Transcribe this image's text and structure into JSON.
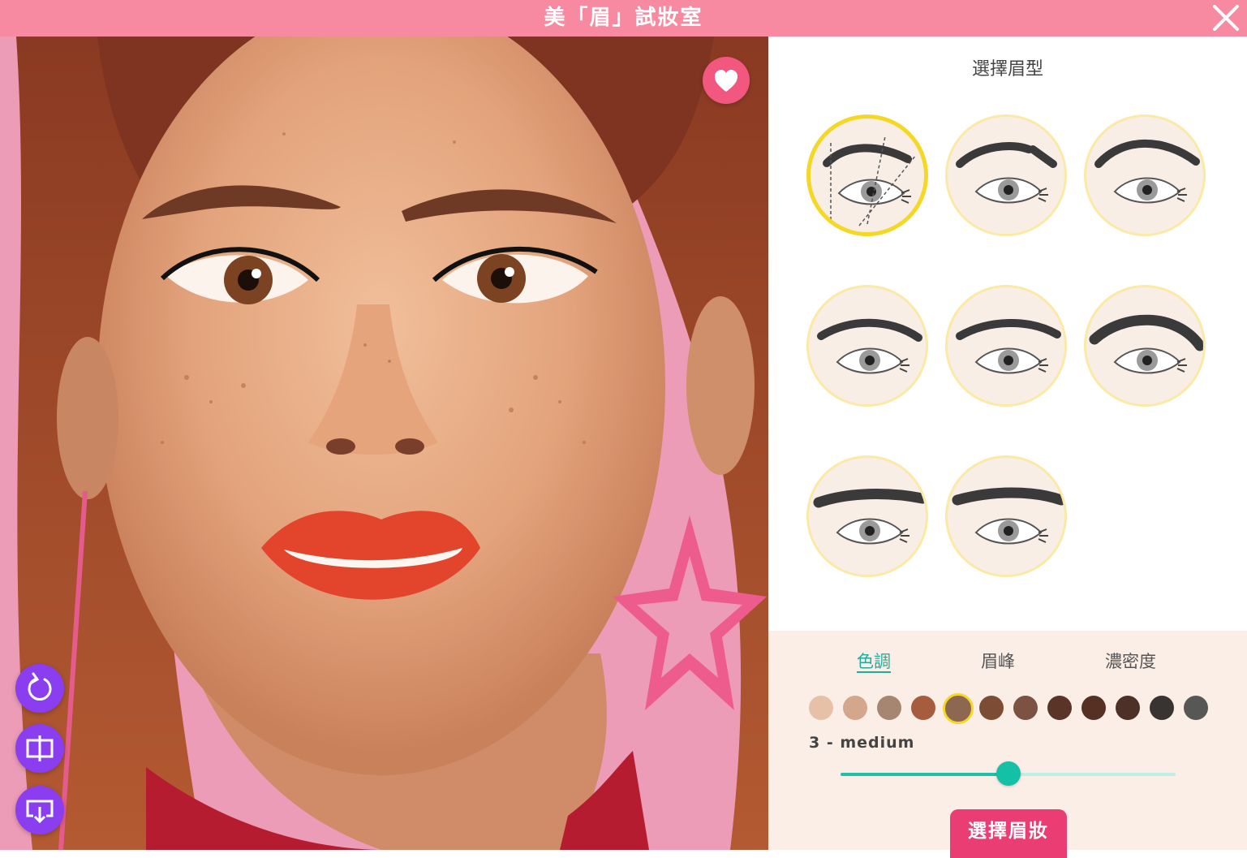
{
  "app": {
    "title": "美「眉」試妝室"
  },
  "panel": {
    "title": "選擇眉型",
    "shapes": [
      {
        "name": "guide",
        "selected": true
      },
      {
        "name": "soft-angled",
        "selected": false
      },
      {
        "name": "arched",
        "selected": false
      },
      {
        "name": "feathered",
        "selected": false
      },
      {
        "name": "straight-thin",
        "selected": false
      },
      {
        "name": "bold-arched",
        "selected": false
      },
      {
        "name": "bold-straight",
        "selected": false
      },
      {
        "name": "thick-flat",
        "selected": false
      }
    ],
    "tabs": [
      {
        "label": "色調",
        "active": true
      },
      {
        "label": "眉峰",
        "active": false
      },
      {
        "label": "濃密度",
        "active": false
      }
    ],
    "swatches": [
      {
        "color": "#e7c0a8",
        "selected": false
      },
      {
        "color": "#d4a68b",
        "selected": false
      },
      {
        "color": "#a68670",
        "selected": false
      },
      {
        "color": "#a65d3f",
        "selected": false
      },
      {
        "color": "#8e6750",
        "selected": true
      },
      {
        "color": "#7d4c35",
        "selected": false
      },
      {
        "color": "#7c5343",
        "selected": false
      },
      {
        "color": "#5a3426",
        "selected": false
      },
      {
        "color": "#573024",
        "selected": false
      },
      {
        "color": "#4d3129",
        "selected": false
      },
      {
        "color": "#383431",
        "selected": false
      },
      {
        "color": "#575756",
        "selected": false
      }
    ],
    "tone_label": "3 - medium",
    "slider_value": 0.5,
    "select_button": "選擇眉妝"
  },
  "colors": {
    "topbar": "#f78aa0",
    "accent": "#1fae9b",
    "button": "#e93d73",
    "tool_buttons": "#8b3ef0",
    "favorite": "#f2577f"
  },
  "icons": [
    "close-icon",
    "heart-icon",
    "reset-icon",
    "compare-icon",
    "download-icon"
  ]
}
